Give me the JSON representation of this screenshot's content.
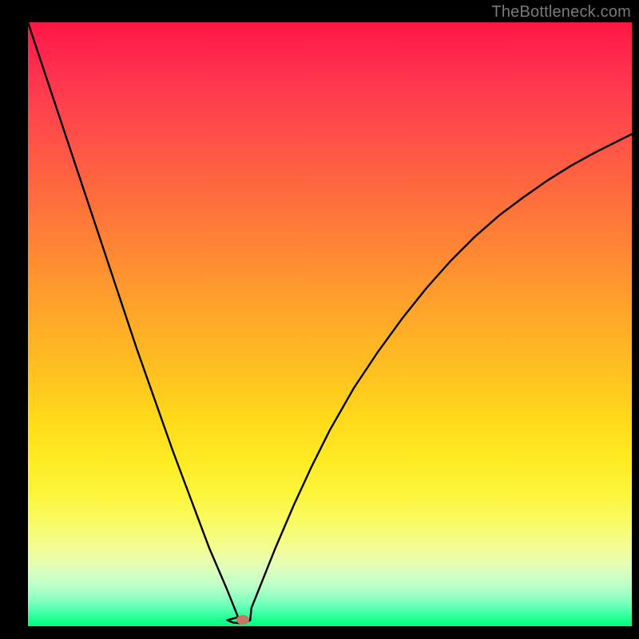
{
  "watermark": "TheBottleneck.com",
  "marker": {
    "x_pct": 35.6,
    "y_pct": 99.0
  },
  "chart_data": {
    "type": "line",
    "title": "",
    "xlabel": "",
    "ylabel": "",
    "xlim": [
      0,
      100
    ],
    "ylim": [
      0,
      100
    ],
    "grid": false,
    "legend": false,
    "series": [
      {
        "name": "left-branch",
        "x": [
          0,
          3,
          6,
          9,
          12,
          15,
          18,
          21,
          24,
          27,
          30,
          31.5,
          33,
          34,
          34.8,
          35.6
        ],
        "y": [
          100,
          91,
          82,
          73,
          64,
          55,
          46,
          37.5,
          29,
          21,
          13,
          9.5,
          6,
          3.5,
          1.5,
          0.5
        ]
      },
      {
        "name": "minimum-flat",
        "x": [
          33.0,
          34.0,
          35.0,
          35.6,
          36.0,
          36.8
        ],
        "y": [
          1.0,
          0.6,
          0.5,
          0.5,
          0.6,
          1.0
        ]
      },
      {
        "name": "right-branch",
        "x": [
          35.6,
          37,
          39,
          41,
          44,
          47,
          50,
          54,
          58,
          62,
          66,
          70,
          74,
          78,
          82,
          86,
          90,
          94,
          98,
          100
        ],
        "y": [
          0.5,
          3,
          8,
          13,
          20,
          26.5,
          32.5,
          39.5,
          45.5,
          51,
          56,
          60.5,
          64.5,
          68,
          71,
          73.8,
          76.3,
          78.5,
          80.5,
          81.5
        ]
      }
    ],
    "annotations": [
      {
        "type": "point",
        "x": 35.6,
        "y": 0.5,
        "label": "minimum-marker"
      }
    ],
    "background_gradient": {
      "orientation": "vertical",
      "stops": [
        {
          "pos": 0.0,
          "color": "#ff1744"
        },
        {
          "pos": 0.5,
          "color": "#ffb126"
        },
        {
          "pos": 0.8,
          "color": "#fcf53b"
        },
        {
          "pos": 1.0,
          "color": "#00ff7a"
        }
      ]
    }
  }
}
